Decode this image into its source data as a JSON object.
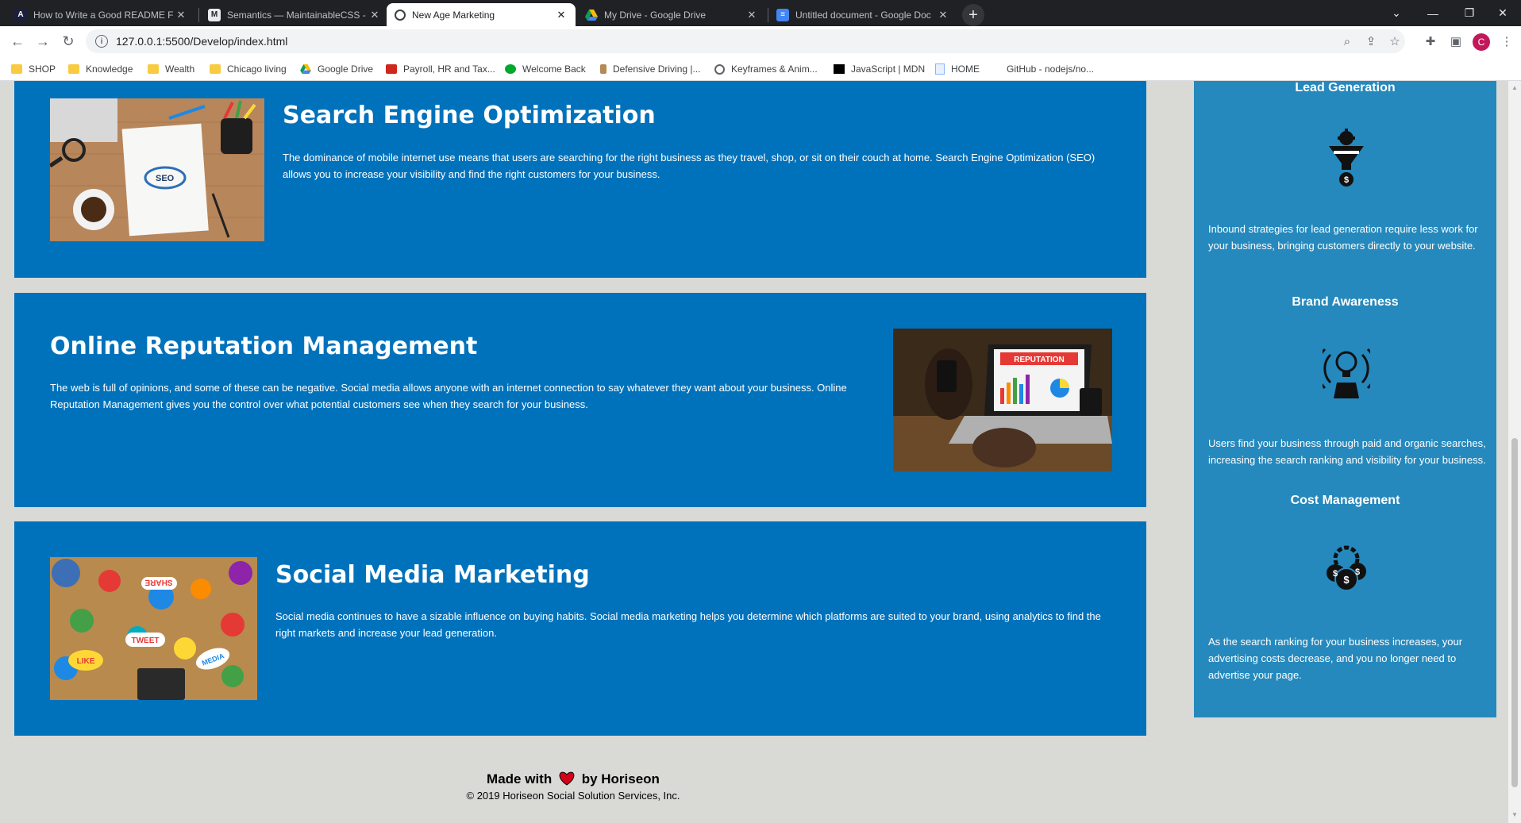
{
  "browser": {
    "tabs": [
      {
        "title": "How to Write a Good README F",
        "favicon": "a-icon",
        "active": false
      },
      {
        "title": "Semantics — MaintainableCSS -",
        "favicon": "m-icon",
        "active": false
      },
      {
        "title": "New Age Marketing",
        "favicon": "globe-icon",
        "active": true
      },
      {
        "title": "My Drive - Google Drive",
        "favicon": "drive-icon",
        "active": false
      },
      {
        "title": "Untitled document - Google Doc",
        "favicon": "docs-icon",
        "active": false
      }
    ],
    "url": "127.0.0.1:5500/Develop/index.html",
    "avatar_letter": "C",
    "bookmarks": [
      {
        "label": "SHOP",
        "icon": "folder-icon"
      },
      {
        "label": "Knowledge",
        "icon": "folder-icon"
      },
      {
        "label": "Wealth",
        "icon": "folder-icon"
      },
      {
        "label": "Chicago living",
        "icon": "folder-icon"
      },
      {
        "label": "Google Drive",
        "icon": "drive-icon"
      },
      {
        "label": "Payroll, HR and Tax...",
        "icon": "adp-icon"
      },
      {
        "label": "Welcome Back",
        "icon": "evernote-icon"
      },
      {
        "label": "Defensive Driving |...",
        "icon": "bottle-icon"
      },
      {
        "label": "Keyframes & Anim...",
        "icon": "globe-icon"
      },
      {
        "label": "JavaScript | MDN",
        "icon": "mdn-icon"
      },
      {
        "label": "HOME",
        "icon": "page-icon"
      },
      {
        "label": "GitHub - nodejs/no...",
        "icon": "blank-icon"
      }
    ]
  },
  "services": [
    {
      "title": "Search Engine Optimization",
      "text": "The dominance of mobile internet use means that users are searching for the right business as they travel, shop, or sit on their couch at home. Search Engine Optimization (SEO) allows you to increase your visibility and find the right customers for your business.",
      "image": "seo-notebook-image"
    },
    {
      "title": "Online Reputation Management",
      "text": "The web is full of opinions, and some of these can be negative. Social media allows anyone with an internet connection to say whatever they want about your business. Online Reputation Management gives you the control over what potential customers see when they search for your business.",
      "image": "reputation-laptop-image",
      "image_label": "REPUTATION"
    },
    {
      "title": "Social Media Marketing",
      "text": "Social media continues to have a sizable influence on buying habits. Social media marketing helps you determine which platforms are suited to your brand, using analytics to find the right markets and increase your lead generation.",
      "image": "social-media-table-image",
      "image_labels": [
        "SHARE",
        "TWEET",
        "LIKE",
        "MEDIA"
      ]
    }
  ],
  "benefits": [
    {
      "title": "Lead Generation",
      "icon": "lead-funnel-icon",
      "text": "Inbound strategies for lead generation require less work for your business, bringing customers directly to your website."
    },
    {
      "title": "Brand Awareness",
      "icon": "brand-broadcast-icon",
      "text": "Users find your business through paid and organic searches, increasing the search ranking and visibility for your business."
    },
    {
      "title": "Cost Management",
      "icon": "cost-gear-coins-icon",
      "text": "As the search ranking for your business increases, your advertising costs decrease, and you no longer need to advertise your page."
    }
  ],
  "footer": {
    "made_with": "Made with",
    "by": "by Horiseon",
    "copyright": "© 2019 Horiseon Social Solution Services, Inc."
  },
  "colors": {
    "page_bg": "#d9d9d6",
    "card_bg": "#0072bb",
    "sidebar_bg": "#2589bd",
    "heart": "#d6001c"
  }
}
